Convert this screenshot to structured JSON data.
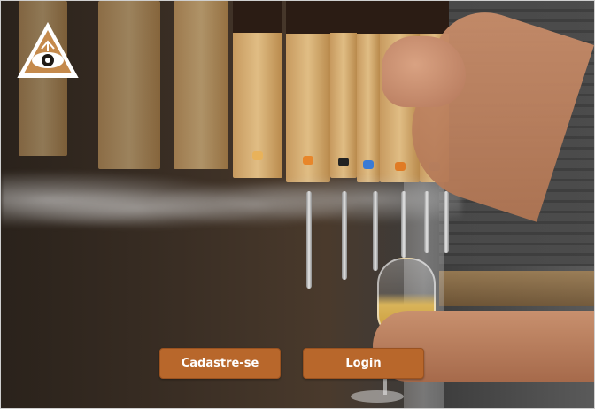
{
  "brand": {
    "logo_icon": "eye-triangle-logo-icon",
    "accent_color": "#b8672b"
  },
  "actions": {
    "signup_label": "Cadastre-se",
    "login_label": "Login"
  }
}
